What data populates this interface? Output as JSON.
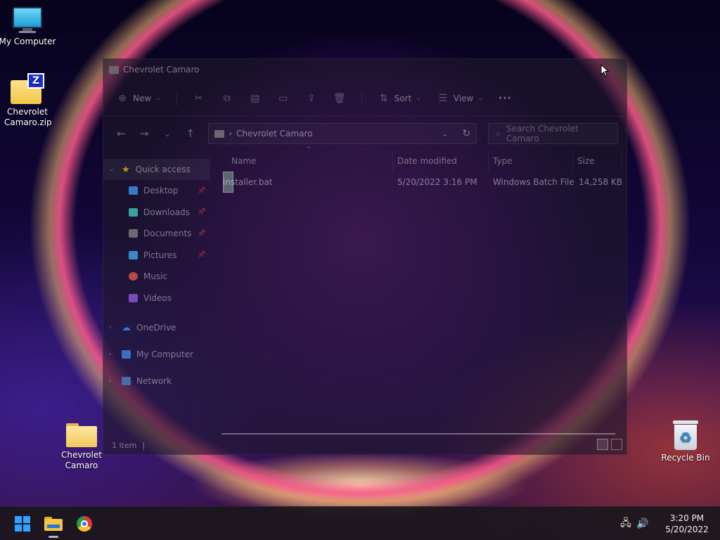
{
  "desktop": {
    "icons": {
      "my_computer": "My Computer",
      "zip": "Chevrolet Camaro.zip",
      "folder": "Chevrolet Camaro",
      "recycle_bin": "Recycle Bin"
    }
  },
  "window": {
    "title": "Chevrolet Camaro",
    "toolbar": {
      "new_label": "New",
      "sort_label": "Sort",
      "view_label": "View",
      "more_label": "···"
    },
    "address": {
      "path": "Chevrolet Camaro",
      "separator": "›",
      "search_placeholder": "Search Chevrolet Camaro"
    },
    "navpane": {
      "quick_access": "Quick access",
      "items": [
        {
          "label": "Desktop",
          "icon": "desktop-icon",
          "color": "#3a78c8"
        },
        {
          "label": "Downloads",
          "icon": "download-icon",
          "color": "#3aa0a0"
        },
        {
          "label": "Documents",
          "icon": "document-icon",
          "color": "#6a6a78"
        },
        {
          "label": "Pictures",
          "icon": "pictures-icon",
          "color": "#3a88c8"
        },
        {
          "label": "Music",
          "icon": "music-icon",
          "color": "#b84848"
        },
        {
          "label": "Videos",
          "icon": "video-icon",
          "color": "#7a4ab8"
        }
      ],
      "onedrive": "OneDrive",
      "my_computer": "My Computer",
      "network": "Network"
    },
    "columns": {
      "name": "Name",
      "date": "Date modified",
      "type": "Type",
      "size": "Size"
    },
    "files": [
      {
        "name": "installer.bat",
        "date": "5/20/2022 3:16 PM",
        "type": "Windows Batch File",
        "size": "14,258 KB"
      }
    ],
    "status": {
      "count": "1 item",
      "separator": "|"
    }
  },
  "taskbar": {
    "time": "3:20 PM",
    "date": "5/20/2022"
  },
  "colors": {
    "accent": "#2ea3ff",
    "folder_yellow": "#f5c641"
  }
}
